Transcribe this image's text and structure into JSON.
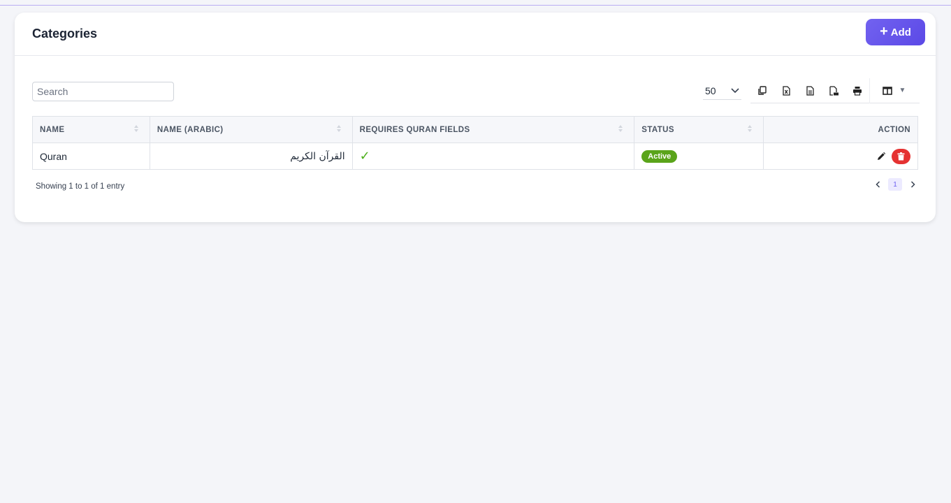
{
  "page": {
    "title": "Categories"
  },
  "header": {
    "add_label": "Add"
  },
  "search": {
    "placeholder": "Search"
  },
  "page_size": {
    "value": "50"
  },
  "toolbar": {
    "buttons": [
      "copy-icon",
      "excel-icon",
      "csv-icon",
      "pdf-icon",
      "print-icon",
      "columns-icon"
    ]
  },
  "table": {
    "columns": [
      "NAME",
      "NAME (ARABIC)",
      "REQUIRES QURAN FIELDS",
      "STATUS",
      "ACTION"
    ],
    "rows": [
      {
        "name": "Quran",
        "name_arabic": "القرآن الكريم",
        "requires_quran_fields": "✓",
        "status": "Active"
      }
    ]
  },
  "footer": {
    "info": "Showing 1 to 1 of 1 entry",
    "current_page": "1"
  },
  "colors": {
    "accent": "#5b49e6",
    "active": "#5aa41a",
    "delete": "#e53232",
    "check": "#4caf1a"
  }
}
